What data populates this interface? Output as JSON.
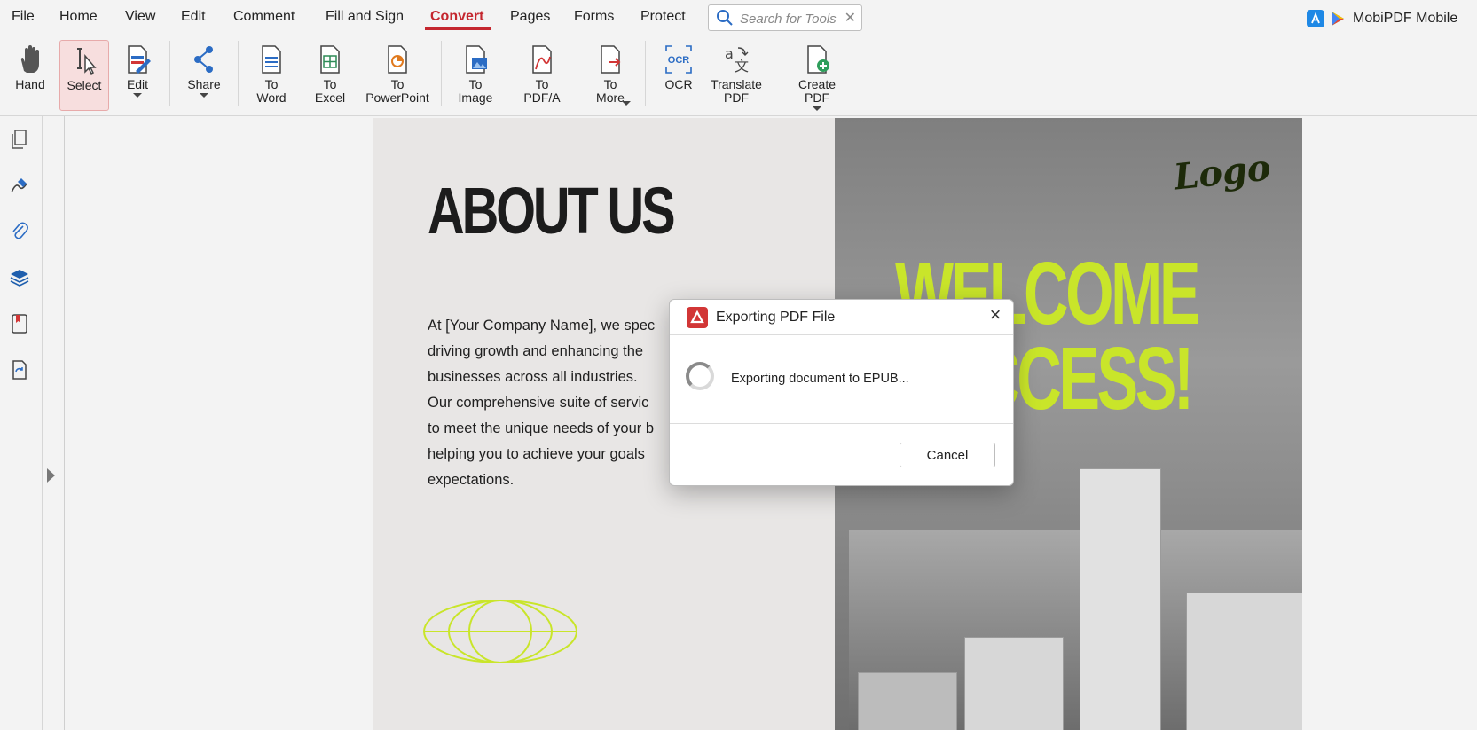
{
  "menu": {
    "items": [
      "File",
      "Home",
      "View",
      "Edit",
      "Comment",
      "Fill and Sign",
      "Convert",
      "Pages",
      "Forms",
      "Protect"
    ],
    "active": "Convert"
  },
  "search": {
    "placeholder": "Search for Tools"
  },
  "brand": {
    "label": "MobiPDF Mobile"
  },
  "toolbar": {
    "hand": "Hand",
    "select": "Select",
    "edit": "Edit",
    "share": "Share",
    "to_word": "To\nWord",
    "to_excel": "To\nExcel",
    "to_powerpoint": "To\nPowerPoint",
    "to_image": "To\nImage",
    "to_pdfa": "To\nPDF/A",
    "to_more": "To\nMore",
    "ocr": "OCR",
    "translate": "Translate\nPDF",
    "create_pdf": "Create PDF"
  },
  "document": {
    "title": "ABOUT US",
    "body_lines": [
      "At [Your Company Name], we spec",
      "driving growth and enhancing the",
      "businesses across all industries.",
      "Our comprehensive suite of servic",
      "to meet the unique needs of your b",
      "helping you to achieve your goals",
      "expectations."
    ],
    "welcome_line1": "WELCOME",
    "welcome_line2": "SUCCESS!",
    "logo": "Logo"
  },
  "dialog": {
    "title": "Exporting PDF File",
    "message": "Exporting document to EPUB...",
    "cancel_label": "Cancel"
  },
  "colors": {
    "accent": "#c4262e",
    "highlight": "#c9e52a"
  }
}
